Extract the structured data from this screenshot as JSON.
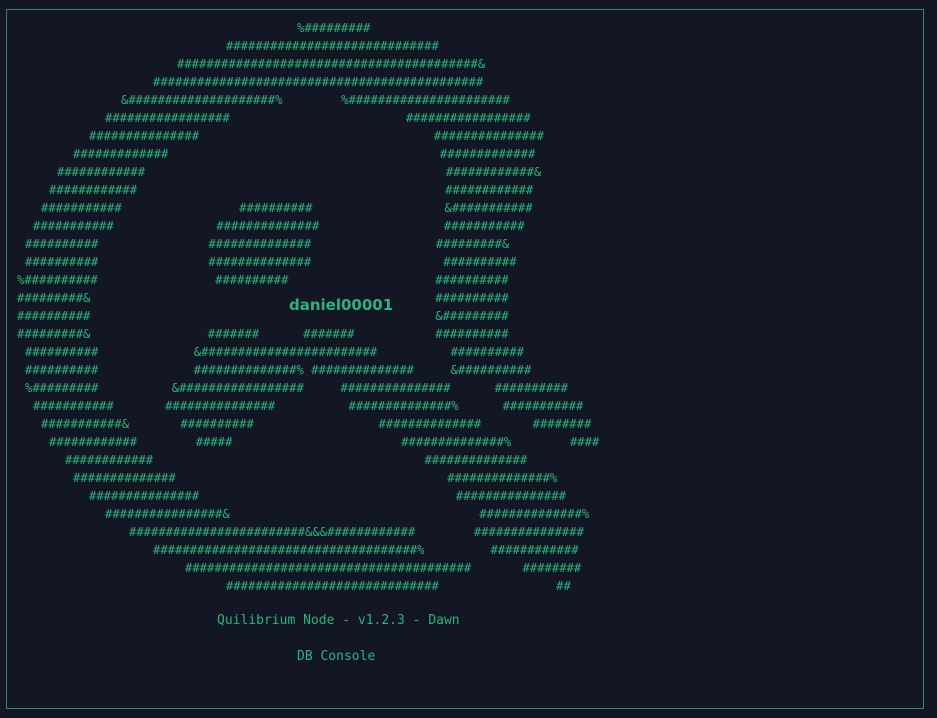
{
  "theme": {
    "background": "#131725",
    "accent": "#2bb37c",
    "border": "#2f8a66"
  },
  "art_lines": [
    "%#########",
    "#############################",
    "#########################################&",
    "#############################################",
    "&####################%        %######################",
    "#################                        #################",
    "###############                                ###############",
    "#############                                     #############",
    "############                                         ############&",
    "############                                          ############",
    "###########                ##########                  &###########",
    "###########              ##############                 ###########",
    "##########               ##############                 #########&",
    "##########               ##############                  ##########",
    "%##########                ##########                    ##########",
    "#########&                                               ##########",
    "##########                                               &#########",
    "#########&                #######      #######           ##########",
    "##########             &########################          ##########",
    "##########             ##############% ##############     &##########",
    "%#########          &#################     ###############      ##########",
    "###########       ###############          ##############%      ###########",
    "###########&       ##########                 ##############       ########",
    "############        #####                       ##############%        ####",
    "############                                     ##############",
    "##############                                     ##############%",
    "###############                                   ###############",
    "################&                                  ##############%",
    "########################&&&############        ###############",
    "####################################%         ############",
    "#######################################       ########",
    "#############################                ##"
  ],
  "username": "daniel00001",
  "footer": {
    "title": "Quilibrium Node - v1.2.3 - Dawn",
    "subtitle": "DB Console"
  }
}
